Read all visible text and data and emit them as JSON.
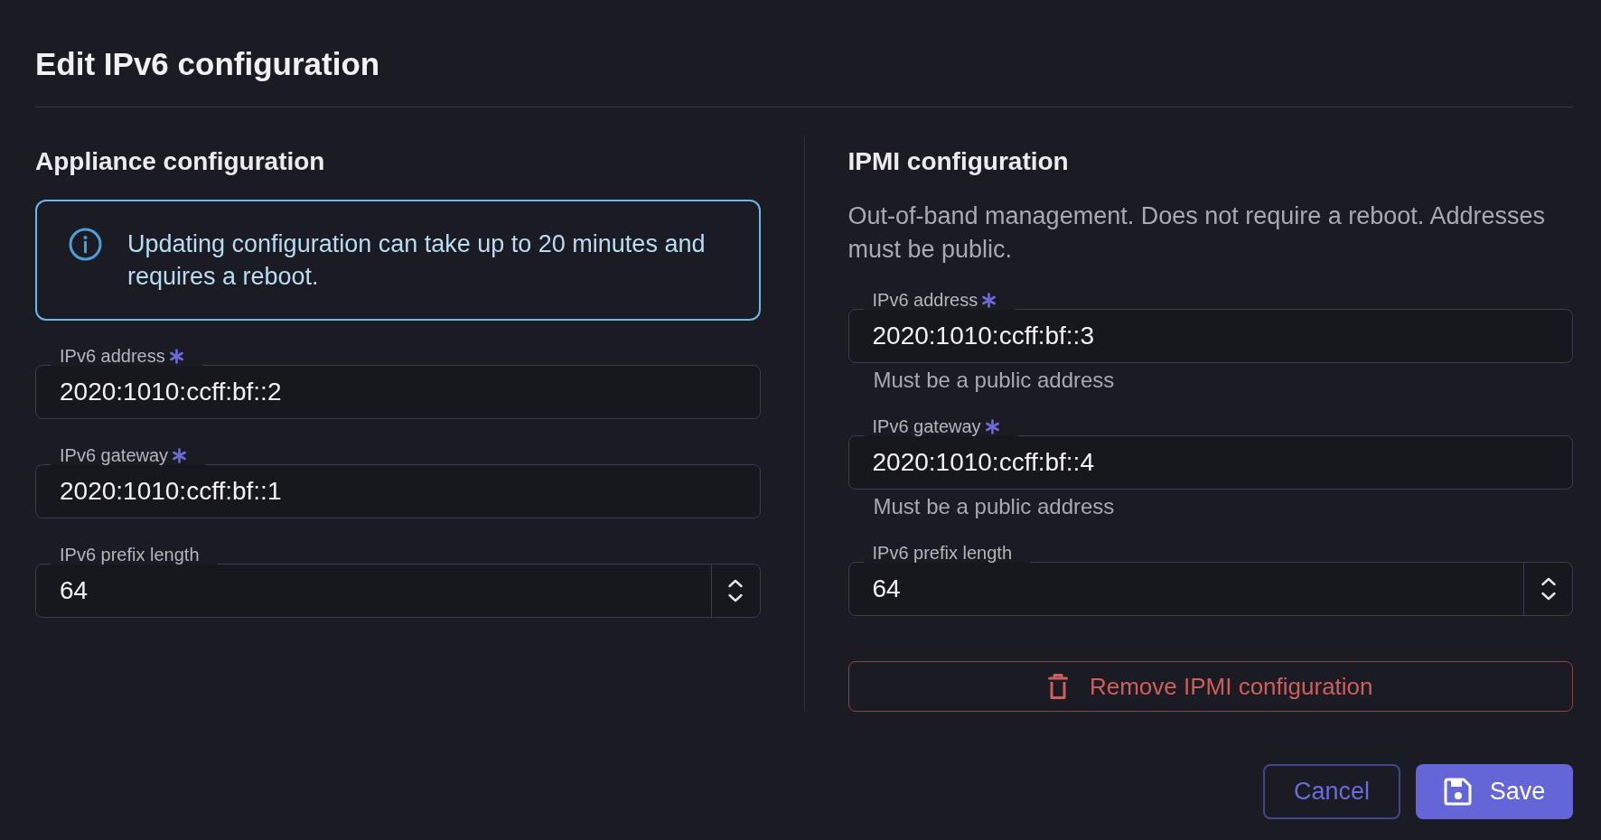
{
  "dialog": {
    "title": "Edit IPv6 configuration"
  },
  "appliance": {
    "heading": "Appliance configuration",
    "notice": "Updating configuration can take up to 20 minutes and requires a reboot.",
    "fields": [
      {
        "kind": "text",
        "label": "IPv6 address",
        "required": true,
        "value": "2020:1010:ccff:bf::2"
      },
      {
        "kind": "text",
        "label": "IPv6 gateway",
        "required": true,
        "value": "2020:1010:ccff:bf::1"
      },
      {
        "kind": "number",
        "label": "IPv6 prefix length",
        "required": false,
        "value": "64"
      }
    ]
  },
  "ipmi": {
    "heading": "IPMI configuration",
    "description": "Out-of-band management. Does not require a reboot. Addresses must be public.",
    "fields": [
      {
        "kind": "text",
        "label": "IPv6 address",
        "required": true,
        "value": "2020:1010:ccff:bf::3",
        "helper": "Must be a public address"
      },
      {
        "kind": "text",
        "label": "IPv6 gateway",
        "required": true,
        "value": "2020:1010:ccff:bf::4",
        "helper": "Must be a public address"
      },
      {
        "kind": "number",
        "label": "IPv6 prefix length",
        "required": false,
        "value": "64"
      }
    ],
    "remove_button": "Remove IPMI configuration"
  },
  "actions": [
    {
      "kind": "secondary",
      "label": "Cancel"
    },
    {
      "kind": "primary",
      "label": "Save"
    }
  ]
}
